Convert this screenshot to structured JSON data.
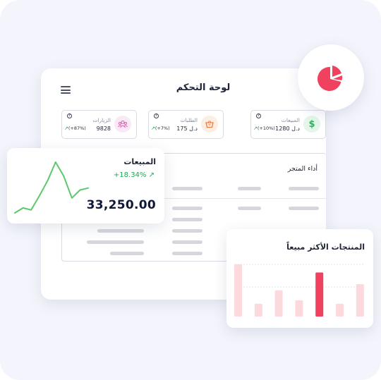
{
  "dashboard": {
    "title": "لوحة التحكم"
  },
  "stats": [
    {
      "label": "المبيعات",
      "value": "1280 د.ل",
      "change": "(+10%)",
      "icon": "dollar-icon",
      "color": "#2fb35d",
      "bg": "#e4f6ea"
    },
    {
      "label": "الطلبات",
      "value": "175 د.ل",
      "change": "(+7%)",
      "icon": "basket-icon",
      "color": "#f07b3a",
      "bg": "#fdeee4"
    },
    {
      "label": "الزيارات",
      "value": "9828",
      "change": "(+87%)",
      "icon": "users-icon",
      "color": "#d663b4",
      "bg": "#fbe8f5"
    }
  ],
  "store_performance": {
    "title": "أداء المتجر"
  },
  "sales": {
    "title": "المبيعات",
    "change": "+18.34%",
    "value": "33,250.00",
    "color": "#5bc96a",
    "trend": [
      3,
      8,
      6,
      20,
      35,
      54,
      40,
      18,
      26,
      28
    ]
  },
  "best_sellers": {
    "title": "المنتجات الأكثر مبيعاً",
    "bar_values": [
      90,
      22,
      45,
      28,
      76,
      22,
      56
    ],
    "highlight_index": 4,
    "bar_color": "#fcd9dd",
    "highlight_color": "#f0425e"
  },
  "pie": {
    "color": "#f0425e",
    "slices": [
      68,
      18,
      14
    ]
  }
}
